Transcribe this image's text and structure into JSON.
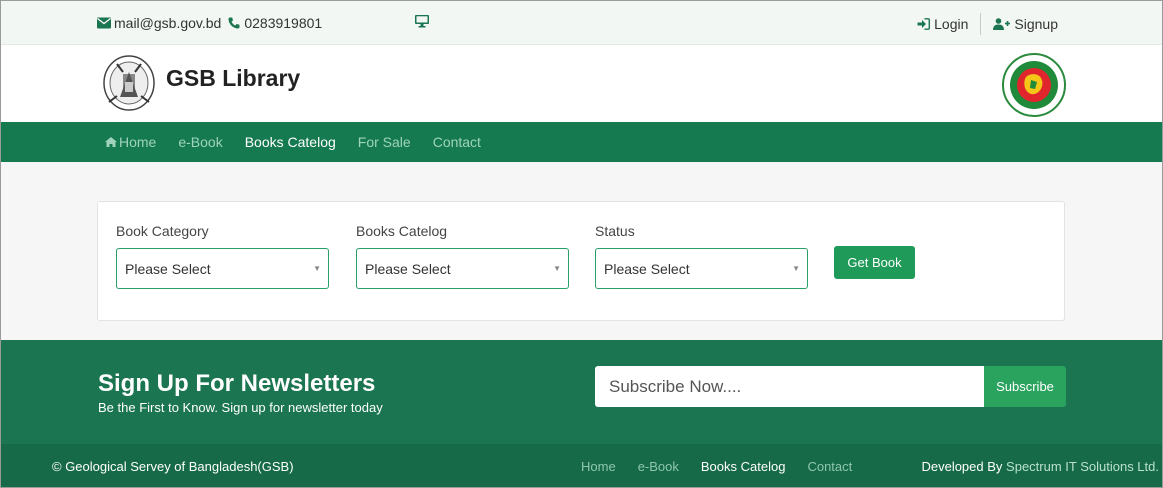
{
  "topbar": {
    "email": "mail@gsb.gov.bd",
    "phone": "0283919801",
    "login": "Login",
    "signup": "Signup",
    "icons": [
      "envelope-icon",
      "phone-icon",
      "monitor-icon",
      "sign-in-icon",
      "user-plus-icon"
    ]
  },
  "brand": {
    "title": "GSB Library"
  },
  "nav": {
    "items": [
      {
        "label": "Home",
        "active": false
      },
      {
        "label": "e-Book",
        "active": false
      },
      {
        "label": "Books Catelog",
        "active": true
      },
      {
        "label": "For Sale",
        "active": false
      },
      {
        "label": "Contact",
        "active": false
      }
    ]
  },
  "search": {
    "fields": [
      {
        "label": "Book Category",
        "value": "Please Select"
      },
      {
        "label": "Books Catelog",
        "value": "Please Select"
      },
      {
        "label": "Status",
        "value": "Please Select"
      }
    ],
    "button": "Get Book"
  },
  "newsletter": {
    "heading": "Sign Up For Newsletters",
    "subtext": "Be the First to Know. Sign up for newsletter today",
    "placeholder": "Subscribe Now....",
    "button": "Subscribe"
  },
  "footer": {
    "copyright": "© Geological Servey of Bangladesh(GSB)",
    "links": [
      {
        "label": "Home",
        "active": false
      },
      {
        "label": "e-Book",
        "active": false
      },
      {
        "label": "Books Catelog",
        "active": true
      },
      {
        "label": "Contact",
        "active": false
      }
    ],
    "developed_by": "Developed By",
    "company": "Spectrum IT Solutions Ltd."
  },
  "colors": {
    "nav_bg": "#157a4f",
    "newsletter_bg": "#1a7550",
    "footer_bg": "#166a48",
    "accent": "#1f9a58"
  }
}
